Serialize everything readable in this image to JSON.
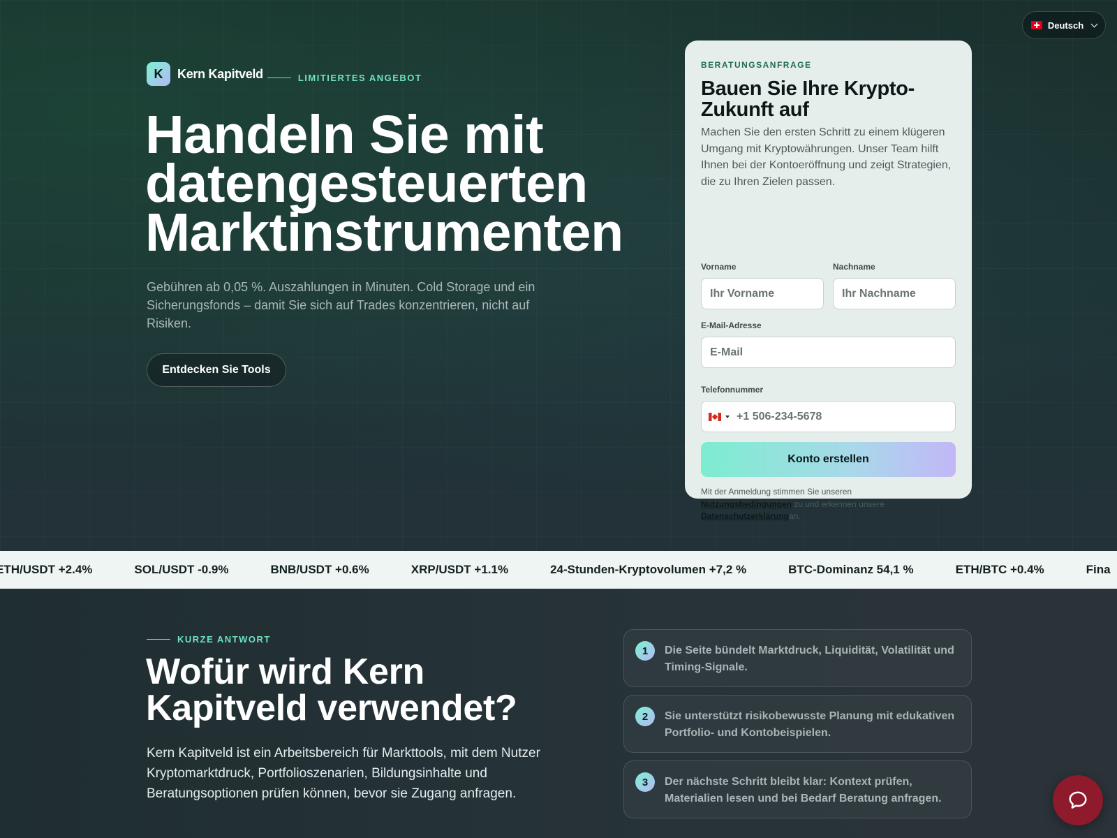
{
  "language": {
    "label": "Deutsch"
  },
  "brand": {
    "name": "Kern Kapitveld",
    "logo_letter": "K",
    "offer": "LIMITIERTES ANGEBOT"
  },
  "hero": {
    "title": "Handeln Sie mit datengesteuerten Marktinstrumenten",
    "subtitle": "Gebühren ab 0,05 %. Auszahlungen in Minuten. Cold Storage und ein Sicherungsfonds – damit Sie sich auf Trades konzentrieren, nicht auf Risiken.",
    "cta": "Entdecken Sie Tools"
  },
  "form": {
    "eyebrow": "BERATUNGSANFRAGE",
    "title": "Bauen Sie Ihre Krypto-Zukunft auf",
    "description": "Machen Sie den ersten Schritt zu einem klügeren Umgang mit Kryptowährungen. Unser Team hilft Ihnen bei der Kontoeröffnung und zeigt Strategien, die zu Ihren Zielen passen.",
    "first_name_label": "Vorname",
    "first_name_placeholder": "Ihr Vorname",
    "last_name_label": "Nachname",
    "last_name_placeholder": "Ihr Nachname",
    "email_label": "E-Mail-Adresse",
    "email_placeholder": "E-Mail",
    "phone_label": "Telefonnummer",
    "phone_placeholder": "+1 506-234-5678",
    "submit": "Konto erstellen",
    "legal_prefix": "Mit der Anmeldung stimmen Sie unseren",
    "terms_link": "Nutzungsbedingungen",
    "legal_middle": "zu und erkennen unsere",
    "privacy_link": "Datenschutzerklärung",
    "legal_suffix": "an."
  },
  "ticker": [
    "ETH/USDT +2.4%",
    "SOL/USDT -0.9%",
    "BNB/USDT +0.6%",
    "XRP/USDT +1.1%",
    "24-Stunden-Kryptovolumen +7,2 %",
    "BTC-Dominanz 54,1 %",
    "ETH/BTC +0.4%",
    "Fina"
  ],
  "about": {
    "kicker": "KURZE ANTWORT",
    "title": "Wofür wird Kern Kapitveld verwendet?",
    "text": "Kern Kapitveld ist ein Arbeitsbereich für Markttools, mit dem Nutzer Kryptomarktdruck, Portfolioszenarien, Bildungsinhalte und Beratungsoptionen prüfen können, bevor sie Zugang anfragen.",
    "steps": [
      {
        "num": "1",
        "text": "Die Seite bündelt Marktdruck, Liquidität, Volatilität und Timing-Signale."
      },
      {
        "num": "2",
        "text": "Sie unterstützt risikobewusste Planung mit edukativen Portfolio- und Kontobeispielen."
      },
      {
        "num": "3",
        "text": "Der nächste Schritt bleibt klar: Kontext prüfen, Materialien lesen und bei Bedarf Beratung anfragen."
      }
    ]
  },
  "icons": {
    "language_flag": "swiss-flag-icon",
    "phone_flag": "canada-flag-icon",
    "chat": "chat-bubble-icon"
  },
  "colors": {
    "accent": "#6fe3c2",
    "chat_button": "#8e1a2c",
    "card_bg": "#e6eeec"
  }
}
